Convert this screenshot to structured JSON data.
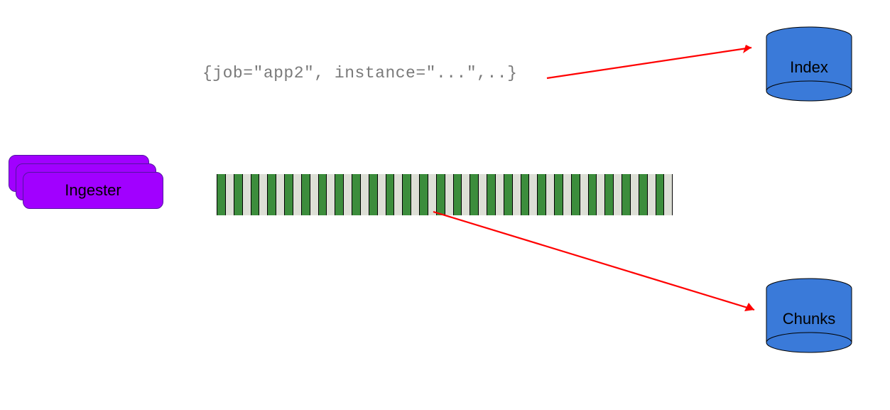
{
  "ingester": {
    "label": "Ingester"
  },
  "query": {
    "text": "{job=\"app2\", instance=\"...\",..}"
  },
  "databases": {
    "index": {
      "label": "Index"
    },
    "chunks": {
      "label": "Chunks"
    }
  },
  "colors": {
    "purple": "#a100ff",
    "stripe_filled": "#3c8d3c",
    "stripe_empty": "#dddfd6",
    "db_fill": "#3a7ad9",
    "arrow": "#ff0000"
  },
  "stripe_count": 54
}
